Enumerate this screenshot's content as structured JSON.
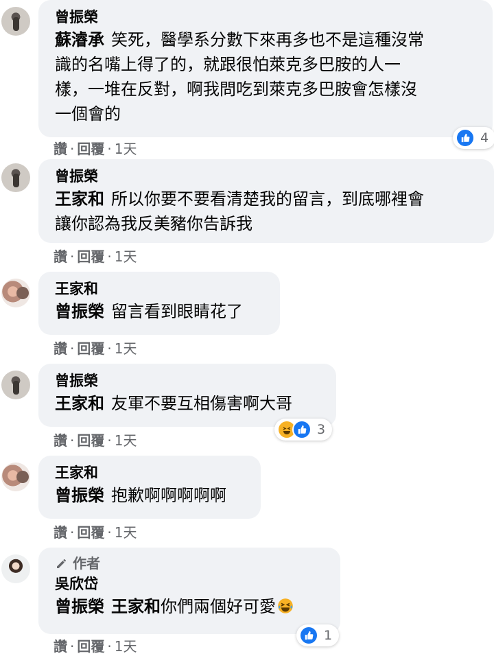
{
  "actions": {
    "like": "讚",
    "reply": "回覆",
    "time": "1天",
    "dot": "·"
  },
  "comments": [
    {
      "name": "曾振榮",
      "tag": "蘇濬承",
      "text_lines": [
        "笑死，醫學系分數下來再多也不是這種沒常",
        "識的名嘴上得了的，就跟很怕萊克多巴胺的人一",
        "樣，一堆在反對，啊我問吃到萊克多巴胺會怎樣沒",
        "一個會的"
      ],
      "reactions": {
        "count": "4",
        "icons": [
          "like-icon"
        ]
      }
    },
    {
      "name": "曾振榮",
      "tag": "王家和",
      "text_lines": [
        "所以你要不要看清楚我的留言，到底哪裡會",
        "讓你認為我反美豬你告訴我"
      ]
    },
    {
      "name": "王家和",
      "tag": "曾振榮",
      "text_lines": [
        "留言看到眼睛花了"
      ]
    },
    {
      "name": "曾振榮",
      "tag": "王家和",
      "text_lines": [
        "友軍不要互相傷害啊大哥"
      ],
      "reactions": {
        "count": "3",
        "icons": [
          "haha-icon",
          "like-icon"
        ]
      }
    },
    {
      "name": "王家和",
      "tag": "曾振榮",
      "text_lines": [
        "抱歉啊啊啊啊啊"
      ]
    },
    {
      "author_badge": "作者",
      "name": "吳欣岱",
      "tag": "曾振榮",
      "tag2": "王家和",
      "text_lines": [
        "你們兩個好可愛"
      ],
      "reactions": {
        "count": "1",
        "icons": [
          "like-icon"
        ]
      }
    }
  ],
  "colors": {
    "bubble": "#f0f2f5",
    "like": "#1877f2",
    "haha": "#f7b125",
    "muted": "#65676b"
  }
}
